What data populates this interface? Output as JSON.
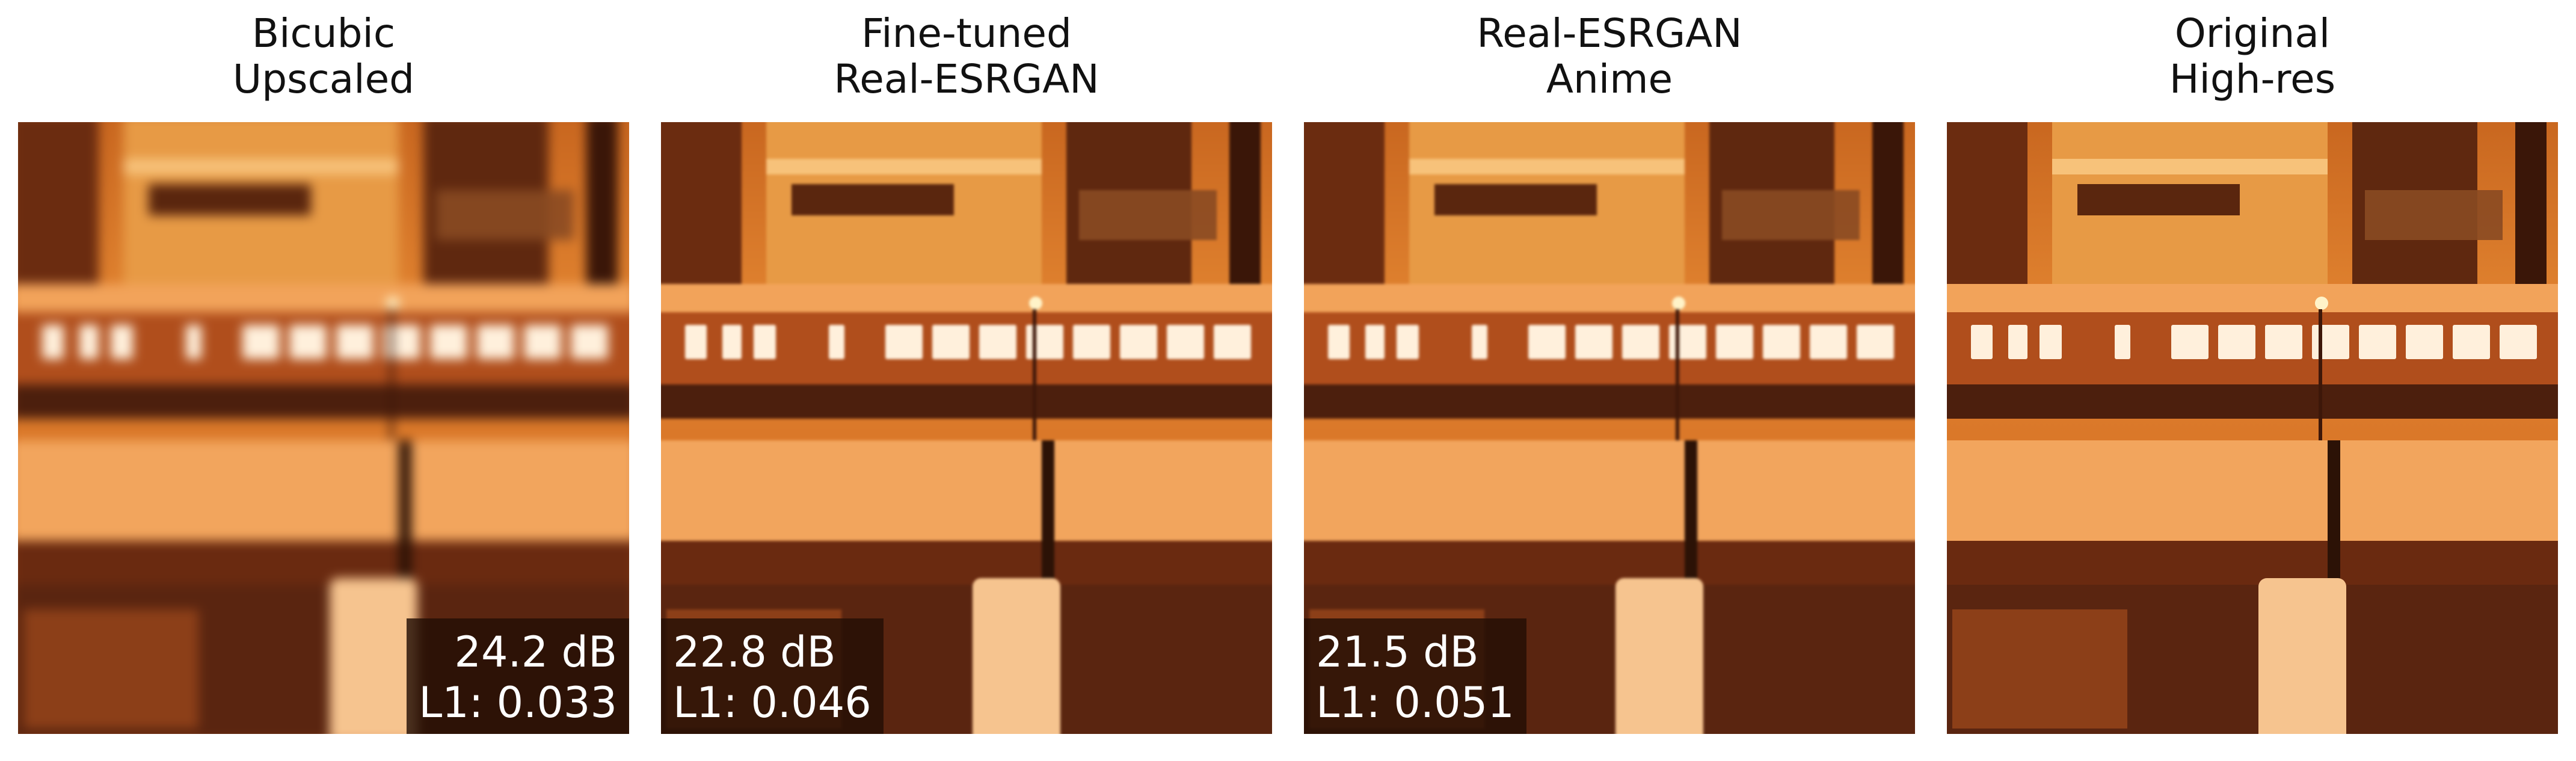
{
  "panels": [
    {
      "title_line1": "Bicubic",
      "title_line2": "Upscaled",
      "psnr": "24.2 dB",
      "l1": "L1: 0.033"
    },
    {
      "title_line1": "Fine-tuned",
      "title_line2": "Real-ESRGAN",
      "psnr": "22.8 dB",
      "l1": "L1: 0.046"
    },
    {
      "title_line1": "Real-ESRGAN",
      "title_line2": "Anime",
      "psnr": "21.5 dB",
      "l1": "L1: 0.051"
    },
    {
      "title_line1": "Original",
      "title_line2": "High-res"
    }
  ],
  "colors": {
    "badge_bg": "#230f05",
    "badge_text": "#ffffff",
    "title_text": "#111111"
  }
}
